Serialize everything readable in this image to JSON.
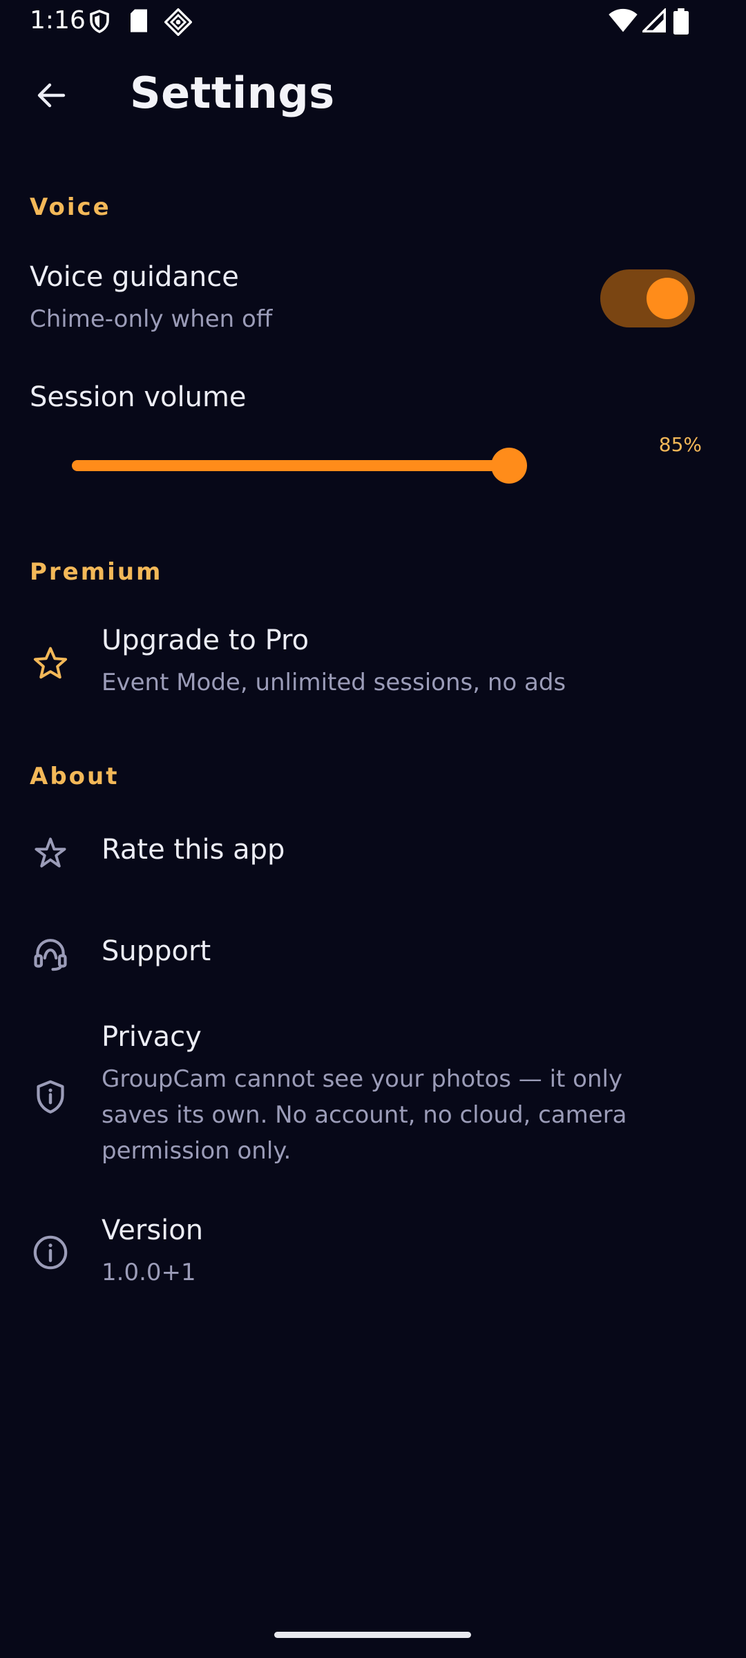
{
  "status_bar": {
    "time": "1:16",
    "icons": [
      "shield-icon",
      "sd-card-icon",
      "app-diamond-icon",
      "wifi-icon",
      "signal-icon",
      "battery-icon"
    ]
  },
  "app_bar": {
    "back_icon": "arrow-left-icon",
    "title": "Settings"
  },
  "sections": {
    "voice": {
      "header": "Voice",
      "voice_guidance": {
        "title": "Voice guidance",
        "subtitle": "Chime-only when off",
        "enabled": true
      },
      "session_volume": {
        "title": "Session volume",
        "value_label": "85%",
        "value": 0.85
      }
    },
    "premium": {
      "header": "Premium",
      "upgrade": {
        "icon": "star-outline-icon",
        "title": "Upgrade to Pro",
        "subtitle": "Event Mode, unlimited sessions, no ads"
      }
    },
    "about": {
      "header": "About",
      "rate": {
        "icon": "star-icon",
        "title": "Rate this app"
      },
      "support": {
        "icon": "headset-icon",
        "title": "Support"
      },
      "privacy": {
        "icon": "shield-info-icon",
        "title": "Privacy",
        "subtitle_lines": [
          "GroupCam cannot see your photos — it only",
          "saves its own. No account, no cloud, camera",
          "permission only."
        ]
      },
      "version": {
        "icon": "info-icon",
        "title": "Version",
        "subtitle": "1.0.0+1"
      }
    }
  },
  "colors": {
    "background": "#070818",
    "accent": "#FF8C1A",
    "section_header": "#F3B858",
    "secondary_text": "#9B9CB8",
    "toggle_track": "#7A4512"
  }
}
